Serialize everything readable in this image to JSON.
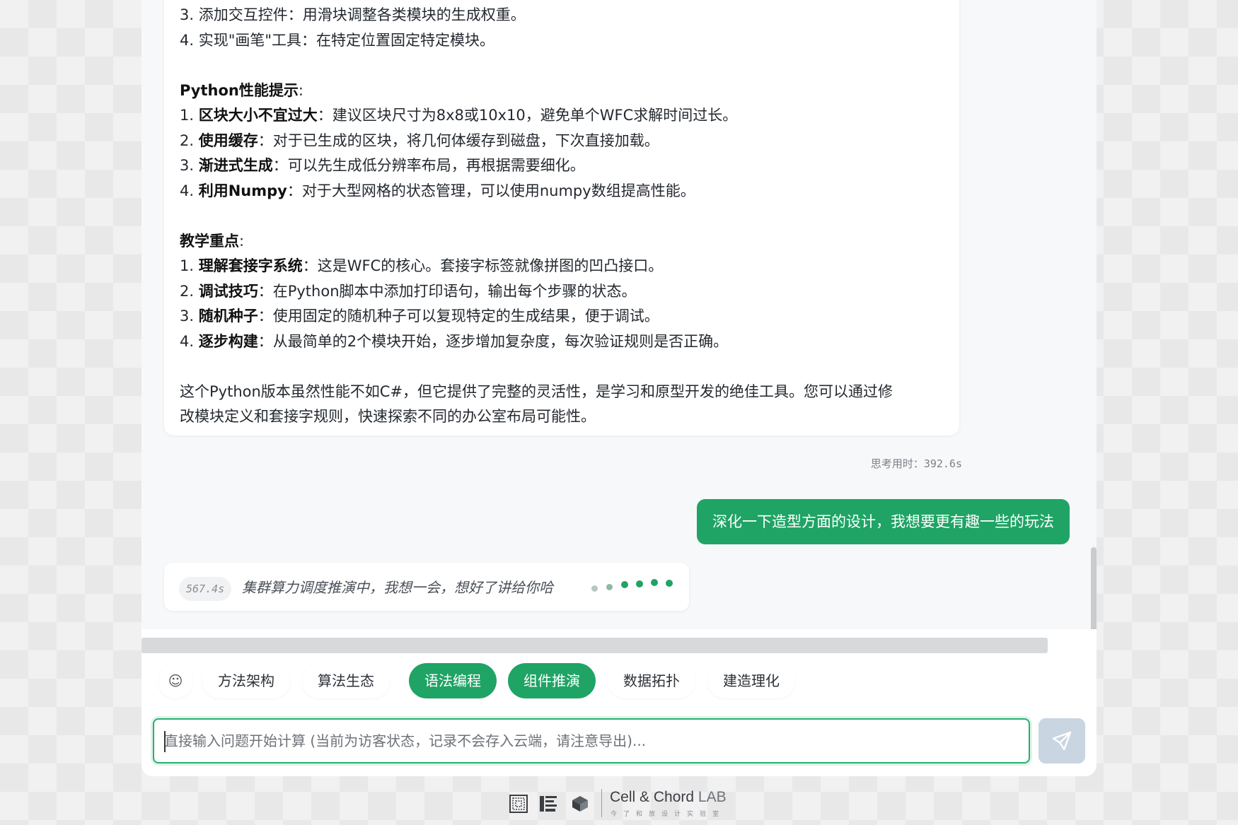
{
  "conversation": {
    "ai_message": {
      "lines_top": [
        "3. 添加交互控件：用滑块调整各类模块的生成权重。",
        "4. 实现\"画笔\"工具：在特定位置固定特定模块。"
      ],
      "perf_heading": "Python性能提示",
      "perf_items": [
        {
          "num": "1. ",
          "bold": "区块大小不宜过大",
          "text": "：建议区块尺寸为8x8或10x10，避免单个WFC求解时间过长。"
        },
        {
          "num": "2. ",
          "bold": "使用缓存",
          "text": "：对于已生成的区块，将几何体缓存到磁盘，下次直接加载。"
        },
        {
          "num": "3. ",
          "bold": "渐进式生成",
          "text": "：可以先生成低分辨率布局，再根据需要细化。"
        },
        {
          "num": "4. ",
          "bold": "利用Numpy",
          "text": "：对于大型网格的状态管理，可以使用numpy数组提高性能。"
        }
      ],
      "teach_heading": "教学重点",
      "teach_items": [
        {
          "num": "1. ",
          "bold": "理解套接字系统",
          "text": "：这是WFC的核心。套接字标签就像拼图的凹凸接口。"
        },
        {
          "num": "2. ",
          "bold": "调试技巧",
          "text": "：在Python脚本中添加打印语句，输出每个步骤的状态。"
        },
        {
          "num": "3. ",
          "bold": "随机种子",
          "text": "：使用固定的随机种子可以复现特定的生成结果，便于调试。"
        },
        {
          "num": "4. ",
          "bold": "逐步构建",
          "text": "：从最简单的2个模块开始，逐步增加复杂度，每次验证规则是否正确。"
        }
      ],
      "closing_line1": "这个Python版本虽然性能不如C#，但它提供了完整的灵活性，是学习和原型开发的绝佳工具。您可以通过修",
      "closing_line2": "改模块定义和套接字规则，快速探索不同的办公室布局可能性。",
      "colon": ":"
    },
    "think_time": "思考用时：392.6s",
    "user_message": "深化一下造型方面的设计，我想要更有趣一些的玩法",
    "loading": {
      "timer": "567.4s",
      "text": "集群算力调度推演中，我想一会，想好了讲给你哈"
    }
  },
  "chips": {
    "emoji": "☺",
    "items": [
      {
        "label": "方法架构",
        "active": false
      },
      {
        "label": "算法生态",
        "active": false
      },
      {
        "label": "语法编程",
        "active": true
      },
      {
        "label": "组件推演",
        "active": true
      },
      {
        "label": "数据拓扑",
        "active": false
      },
      {
        "label": "建造理化",
        "active": false
      }
    ]
  },
  "input": {
    "placeholder": "直接输入问题开始计算 (当前为访客状态，记录不会存入云端，请注意导出)...",
    "value": ""
  },
  "send_button": {
    "icon": "send-icon"
  },
  "footer": {
    "brand": "Cell & Chord",
    "brand_suffix": "LAB",
    "brand_sub": "今了和放设计实验室"
  },
  "colors": {
    "accent": "#1fa465",
    "send_disabled": "#c9d5e1",
    "dot_light": "#b8c8bf",
    "dot_green": "#1fa465"
  }
}
